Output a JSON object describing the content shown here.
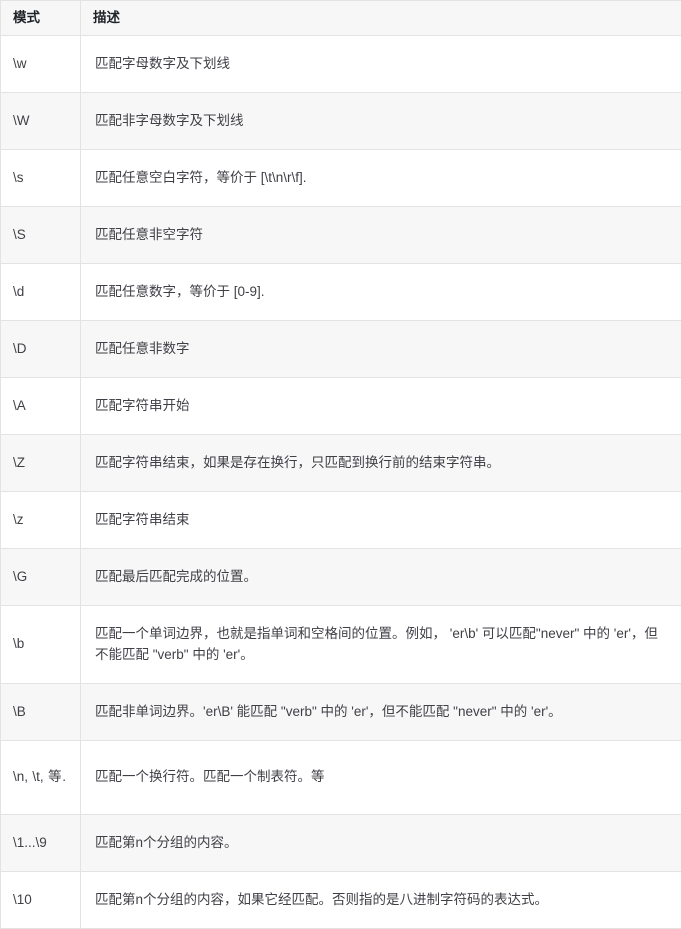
{
  "table": {
    "headers": {
      "pattern": "模式",
      "description": "描述"
    },
    "rows": [
      {
        "pattern": "\\w",
        "description": "匹配字母数字及下划线"
      },
      {
        "pattern": "\\W",
        "description": "匹配非字母数字及下划线"
      },
      {
        "pattern": "\\s",
        "description": "匹配任意空白字符，等价于 [\\t\\n\\r\\f]."
      },
      {
        "pattern": "\\S",
        "description": "匹配任意非空字符"
      },
      {
        "pattern": "\\d",
        "description": "匹配任意数字，等价于 [0-9]."
      },
      {
        "pattern": "\\D",
        "description": "匹配任意非数字"
      },
      {
        "pattern": "\\A",
        "description": "匹配字符串开始"
      },
      {
        "pattern": "\\Z",
        "description": "匹配字符串结束，如果是存在换行，只匹配到换行前的结束字符串。"
      },
      {
        "pattern": "\\z",
        "description": "匹配字符串结束"
      },
      {
        "pattern": "\\G",
        "description": "匹配最后匹配完成的位置。"
      },
      {
        "pattern": "\\b",
        "description": "匹配一个单词边界，也就是指单词和空格间的位置。例如， 'er\\b' 可以匹配\"never\" 中的 'er'，但不能匹配 \"verb\" 中的 'er'。"
      },
      {
        "pattern": "\\B",
        "description": "匹配非单词边界。'er\\B' 能匹配 \"verb\" 中的 'er'，但不能匹配 \"never\" 中的 'er'。"
      },
      {
        "pattern": "\\n, \\t, 等.",
        "description": "匹配一个换行符。匹配一个制表符。等"
      },
      {
        "pattern": "\\1...\\9",
        "description": "匹配第n个分组的内容。"
      },
      {
        "pattern": "\\10",
        "description": "匹配第n个分组的内容，如果它经匹配。否则指的是八进制字符码的表达式。"
      }
    ]
  },
  "colors": {
    "header_bg": "#f7f7f7",
    "stripe_bg": "#f7f7f7",
    "row_bg": "#ffffff",
    "border": "#e3e3e3",
    "text": "#3f3f46",
    "header_text": "#1f2328"
  }
}
